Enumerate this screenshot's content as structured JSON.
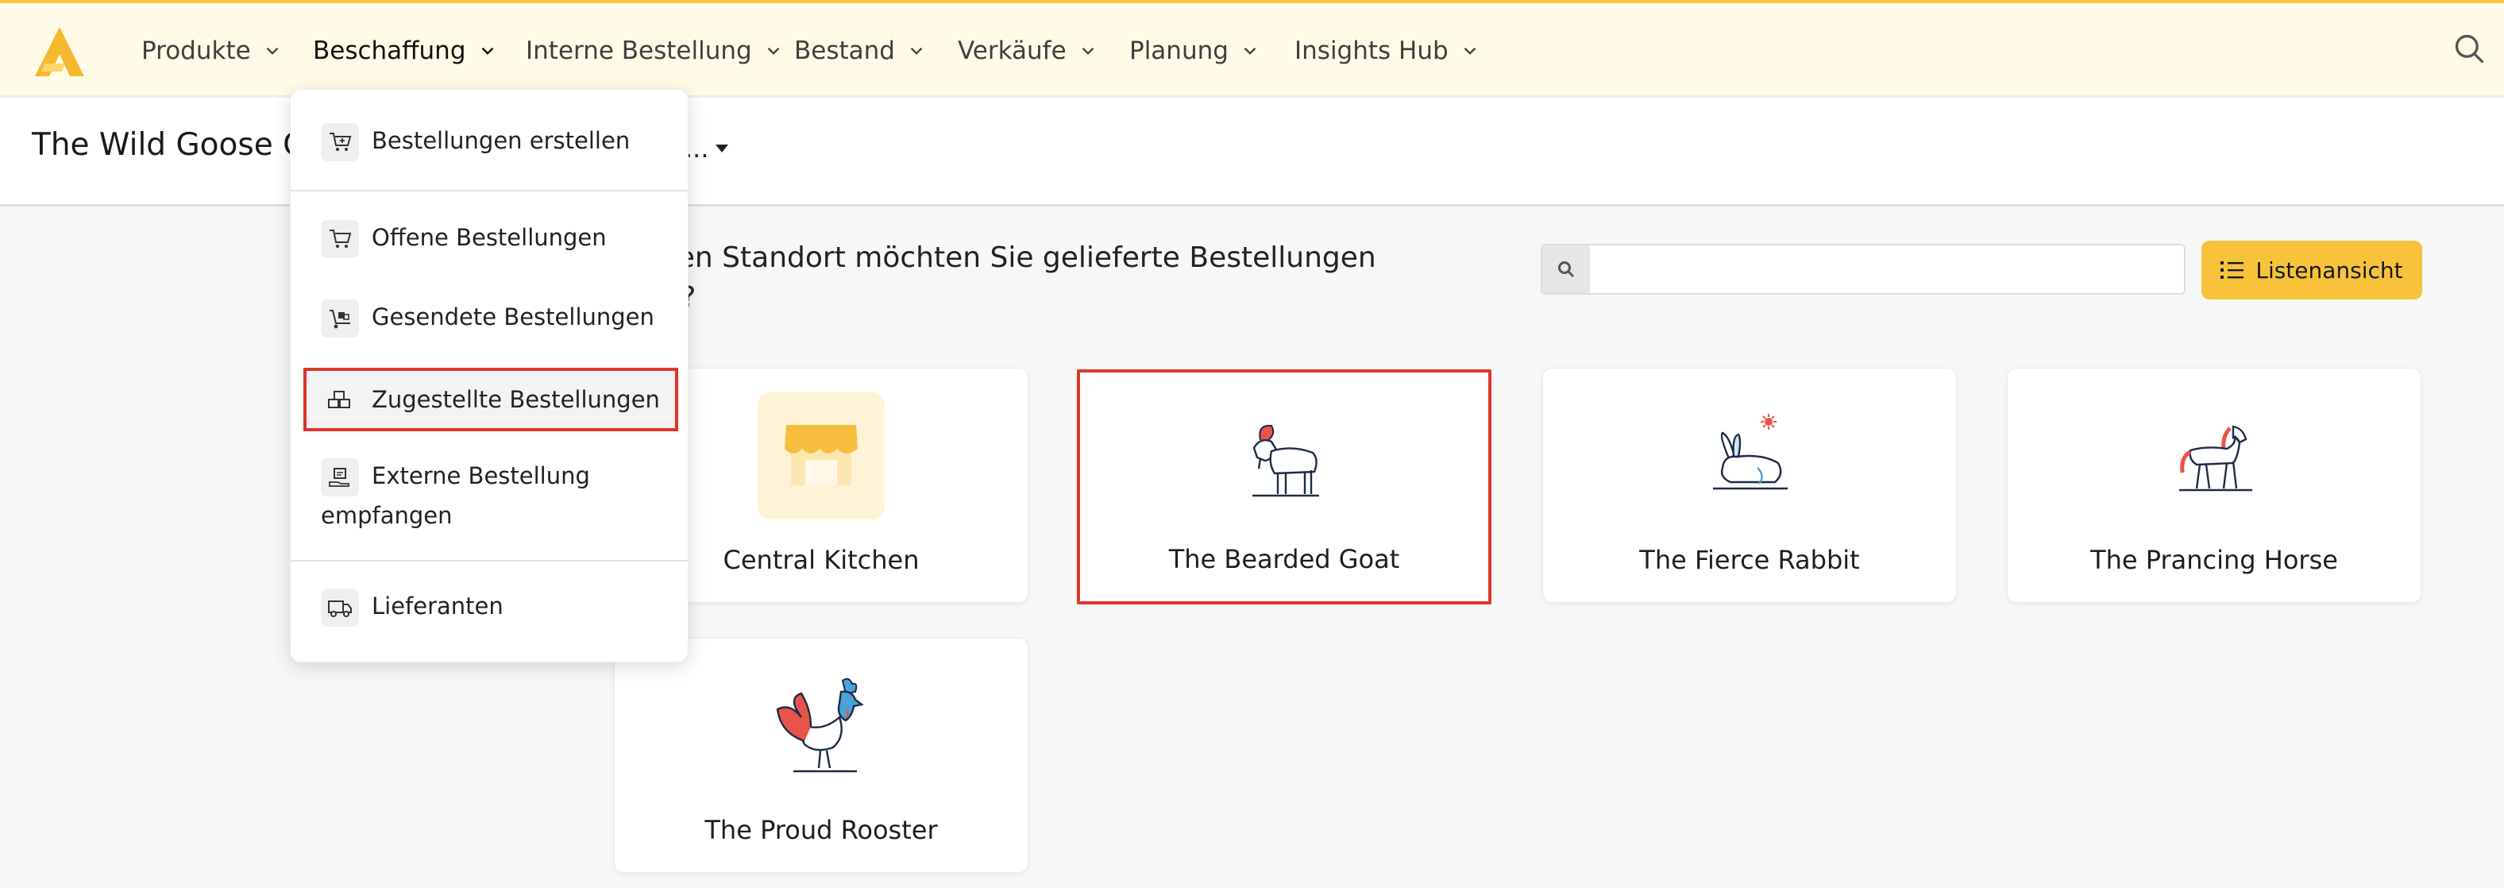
{
  "nav": {
    "items": [
      {
        "label": "Produkte"
      },
      {
        "label": "Beschaffung"
      },
      {
        "label": "Interne Bestellung"
      },
      {
        "label": "Bestand"
      },
      {
        "label": "Verkäufe"
      },
      {
        "label": "Planung"
      },
      {
        "label": "Insights Hub"
      }
    ]
  },
  "header": {
    "title": "The Wild Goose C",
    "location_select": "..."
  },
  "main": {
    "question_line1": "elchen Standort möchten Sie gelieferte Bestellungen",
    "question_line2": "gen ?",
    "search_placeholder": "",
    "list_view_label": "Listenansicht"
  },
  "locations": [
    {
      "name": "Central Kitchen",
      "icon": "store-icon"
    },
    {
      "name": "The Bearded Goat",
      "icon": "goat-icon"
    },
    {
      "name": "The Fierce Rabbit",
      "icon": "rabbit-icon"
    },
    {
      "name": "The Prancing Horse",
      "icon": "horse-icon"
    },
    {
      "name": "The Proud Rooster",
      "icon": "rooster-icon"
    }
  ],
  "dropdown": {
    "items": [
      {
        "label": "Bestellungen erstellen",
        "icon": "cart-plus-icon"
      },
      {
        "label": "Offene Bestellungen",
        "icon": "cart-icon"
      },
      {
        "label": "Gesendete Bestellungen",
        "icon": "dolly-icon"
      },
      {
        "label": "Zugestellte Bestellungen",
        "icon": "boxes-icon"
      },
      {
        "label_line1": "Externe Bestellung",
        "label_line2": "empfangen",
        "icon": "receive-icon"
      },
      {
        "label": "Lieferanten",
        "icon": "truck-icon"
      }
    ]
  },
  "colors": {
    "accent": "#f7c33a",
    "topbar_bg": "#fffbe6",
    "highlight": "#e0352b"
  }
}
